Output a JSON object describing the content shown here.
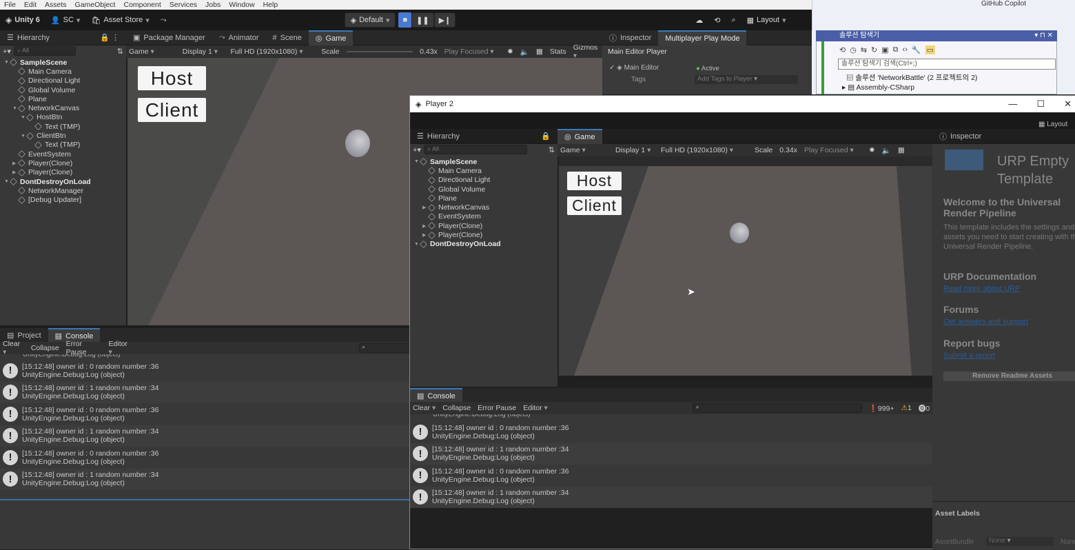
{
  "menu": [
    "File",
    "Edit",
    "Assets",
    "GameObject",
    "Component",
    "Services",
    "Jobs",
    "Window",
    "Help"
  ],
  "toolbar": {
    "logo": "Unity 6",
    "account": "SC",
    "asset_store": "Asset Store",
    "layout_default": "Default",
    "layout": "Layout"
  },
  "main_tabs": {
    "hierarchy": "Hierarchy",
    "package_manager": "Package Manager",
    "animator": "Animator",
    "scene": "Scene",
    "game": "Game",
    "inspector": "Inspector",
    "mppm": "Multiplayer Play Mode"
  },
  "main_game": {
    "mode": "Game",
    "display": "Display 1",
    "resolution": "Full HD (1920x1080)",
    "scale_label": "Scale",
    "scale": "0.43x",
    "play_focused": "Play Focused",
    "stats": "Stats",
    "gizmos": "Gizmos",
    "host": "Host",
    "client": "Client"
  },
  "hierarchy": {
    "search": "All",
    "rows": [
      {
        "t": "SampleScene",
        "d": 0,
        "scene": true
      },
      {
        "t": "Main Camera",
        "d": 1
      },
      {
        "t": "Directional Light",
        "d": 1
      },
      {
        "t": "Global Volume",
        "d": 1
      },
      {
        "t": "Plane",
        "d": 1
      },
      {
        "t": "NetworkCanvas",
        "d": 1,
        "open": true
      },
      {
        "t": "HostBtn",
        "d": 2,
        "open": true
      },
      {
        "t": "Text (TMP)",
        "d": 3
      },
      {
        "t": "ClientBtn",
        "d": 2,
        "open": true
      },
      {
        "t": "Text (TMP)",
        "d": 3
      },
      {
        "t": "EventSystem",
        "d": 1
      },
      {
        "t": "Player(Clone)",
        "d": 1,
        "closed": true
      },
      {
        "t": "Player(Clone)",
        "d": 1,
        "closed": true
      },
      {
        "t": "DontDestroyOnLoad",
        "d": 0,
        "scene": true
      },
      {
        "t": "NetworkManager",
        "d": 1
      },
      {
        "t": "[Debug Updater]",
        "d": 1
      }
    ]
  },
  "mppm": {
    "title": "Main Editor Player",
    "main_editor": "Main Editor",
    "active": "Active",
    "tags": "Tags",
    "add_tags": "Add Tags to Player"
  },
  "console_tabs": {
    "project": "Project",
    "console": "Console"
  },
  "console_bar": {
    "clear": "Clear",
    "collapse": "Collapse",
    "error_pause": "Error Pause",
    "editor": "Editor"
  },
  "logs": [
    {
      "a": "[15:12:48] owner id : 0 random number :36",
      "b": "UnityEngine.Debug:Log (object)"
    },
    {
      "a": "[15:12:48] owner id : 1 random number :34",
      "b": "UnityEngine.Debug:Log (object)"
    },
    {
      "a": "[15:12:48] owner id : 0 random number :36",
      "b": "UnityEngine.Debug:Log (object)"
    },
    {
      "a": "[15:12:48] owner id : 1 random number :34",
      "b": "UnityEngine.Debug:Log (object)"
    },
    {
      "a": "[15:12:48] owner id : 0 random number :36",
      "b": "UnityEngine.Debug:Log (object)"
    },
    {
      "a": "[15:12:48] owner id : 1 random number :34",
      "b": "UnityEngine.Debug:Log (object)"
    }
  ],
  "log_top_partial": "UnityEngine.Debug:Log (object)",
  "vs": {
    "copilot": "GitHub Copilot",
    "title": "솔루션 탐색기",
    "search": "솔루션 탐색기 검색(Ctrl+;)",
    "solution": "솔루션 'NetworkBattle' (2 프로젝트의 2)",
    "assembly": "Assembly-CSharp"
  },
  "player2": {
    "title": "Player 2",
    "hierarchy": "Hierarchy",
    "game": "Game",
    "inspector": "Inspector",
    "layout": "Layout",
    "game_mode": "Game",
    "display": "Display 1",
    "resolution": "Full HD (1920x1080)",
    "scale_label": "Scale",
    "scale": "0.34x",
    "play_focused": "Play Focused",
    "host": "Host",
    "client": "Client",
    "search": "All",
    "rows": [
      {
        "t": "SampleScene",
        "d": 0,
        "scene": true
      },
      {
        "t": "Main Camera",
        "d": 1
      },
      {
        "t": "Directional Light",
        "d": 1
      },
      {
        "t": "Global Volume",
        "d": 1
      },
      {
        "t": "Plane",
        "d": 1
      },
      {
        "t": "NetworkCanvas",
        "d": 1,
        "closed": true
      },
      {
        "t": "EventSystem",
        "d": 1
      },
      {
        "t": "Player(Clone)",
        "d": 1,
        "closed": true
      },
      {
        "t": "Player(Clone)",
        "d": 1,
        "closed": true
      },
      {
        "t": "DontDestroyOnLoad",
        "d": 0,
        "scene": true,
        "closed": true
      }
    ],
    "console": "Console",
    "clear": "Clear",
    "collapse": "Collapse",
    "error_pause": "Error Pause",
    "editor": "Editor",
    "count_logs": "999+",
    "count_warn": "1",
    "count_err": "0",
    "logs": [
      {
        "a": "[15:12:48] owner id : 0 random number :36",
        "b": "UnityEngine.Debug:Log (object)"
      },
      {
        "a": "[15:12:48] owner id : 1 random number :34",
        "b": "UnityEngine.Debug:Log (object)"
      },
      {
        "a": "[15:12:48] owner id : 0 random number :36",
        "b": "UnityEngine.Debug:Log (object)"
      },
      {
        "a": "[15:12:48] owner id : 1 random number :34",
        "b": "UnityEngine.Debug:Log (object)"
      }
    ],
    "readme_title": "URP Empty Template",
    "welcome": "Welcome to the Universal Render Pipeline",
    "welcome_body": "This template includes the settings and assets you need to start creating with the Universal Render Pipeline.",
    "docs": "URP Documentation",
    "docs_link": "Read more about URP",
    "forums": "Forums",
    "forums_link": "Get answers and support",
    "bugs": "Report bugs",
    "bugs_link": "Submit a report",
    "remove": "Remove Readme Assets",
    "asset_labels": "Asset Labels",
    "asset_bundle": "AssetBundle",
    "none": "None",
    "none2": "None"
  }
}
